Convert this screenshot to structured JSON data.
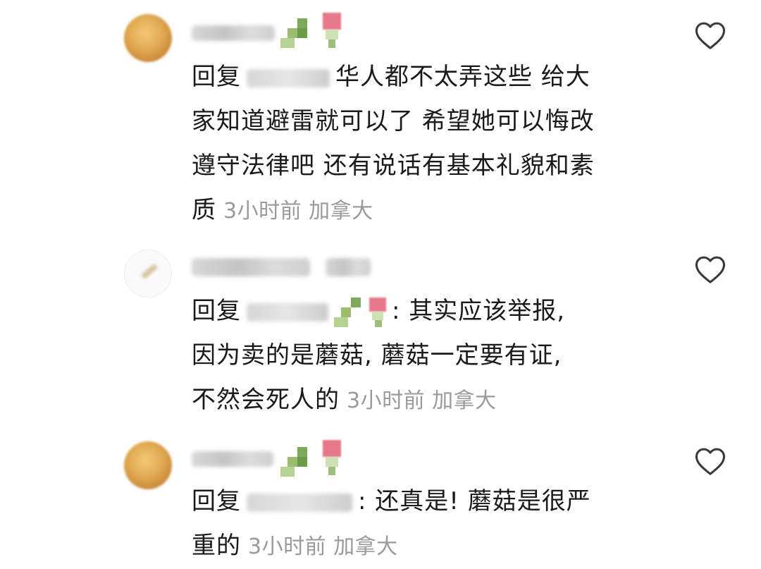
{
  "comments": [
    {
      "prefix": "回复",
      "lines": [
        "华人都不太弄这些  给大",
        "家知道避雷就可以了 希望她可以悔改",
        "遵守法律吧  还有说话有基本礼貌和素",
        "质"
      ],
      "time": "3小时前",
      "location": "加拿大"
    },
    {
      "prefix": "回复",
      "lines": [
        ": 其实应该举报,",
        "因为卖的是蘑菇, 蘑菇一定要有证,",
        "不然会死人的"
      ],
      "time": "3小时前",
      "location": "加拿大"
    },
    {
      "prefix": "回复",
      "lines": [
        ": 还真是! 蘑菇是很严",
        "重的"
      ],
      "time": "3小时前",
      "location": "加拿大"
    }
  ],
  "icons": {
    "like": "heart-outline-icon",
    "leaf": "clover-emoji",
    "rose": "rose-emoji"
  },
  "colors": {
    "text": "#1a1a1a",
    "meta": "#9a9a9a",
    "heart": "#3a3a3a"
  }
}
